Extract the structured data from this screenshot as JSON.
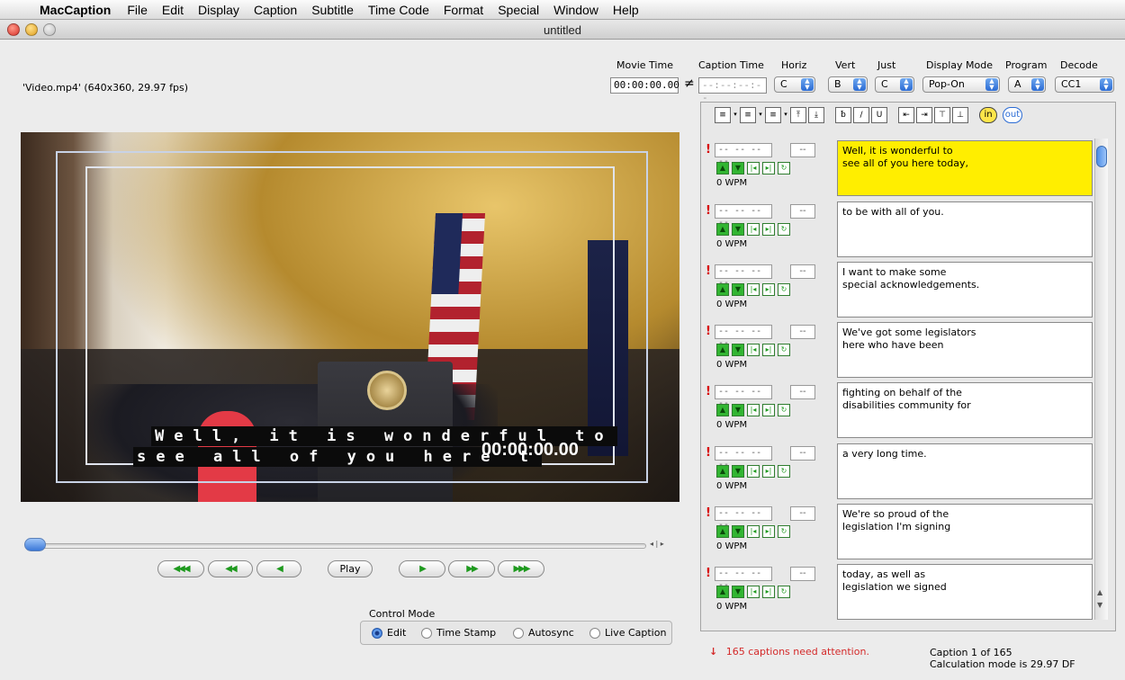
{
  "menubar": {
    "app_name": "MacCaption",
    "items": [
      "File",
      "Edit",
      "Display",
      "Caption",
      "Subtitle",
      "Time Code",
      "Format",
      "Special",
      "Window",
      "Help"
    ]
  },
  "window": {
    "title": "untitled"
  },
  "file_info": "'Video.mp4'  (640x360, 29.97 fps)",
  "controls": {
    "movie_time_label": "Movie Time",
    "movie_time_value": "00:00:00.00",
    "neq_symbol": "≠",
    "caption_time_label": "Caption Time",
    "caption_time_value": "--:--:--:--",
    "horiz_label": "Horiz",
    "horiz_value": "C",
    "vert_label": "Vert",
    "vert_value": "B",
    "just_label": "Just",
    "just_value": "C",
    "display_mode_label": "Display Mode",
    "display_mode_value": "Pop-On",
    "program_label": "Program",
    "program_value": "A",
    "decode_label": "Decode",
    "decode_value": "CC1"
  },
  "video": {
    "caption_line1": "Well, it is wonderful to",
    "caption_line2": "see all of you here t",
    "timecode_overlay": "00:00:00.00"
  },
  "transport": {
    "play_label": "Play",
    "rewind_fast": "◀◀◀",
    "rewind": "◀◀",
    "step_back": "◀",
    "step_fwd": "▶",
    "fwd": "▶▶",
    "fwd_fast": "▶▶▶"
  },
  "control_mode": {
    "label": "Control Mode",
    "options": [
      "Edit",
      "Time Stamp",
      "Autosync",
      "Live Caption"
    ],
    "selected": "Edit"
  },
  "caption_toolbar": {
    "in_label": "in",
    "out_label": "out"
  },
  "captions": [
    {
      "tc_in": "-- -- -- --",
      "dur": "--",
      "wpm": "0 WPM",
      "text": "Well, it is wonderful to\nsee all of you here today,",
      "selected": true
    },
    {
      "tc_in": "-- -- -- --",
      "dur": "--",
      "wpm": "0 WPM",
      "text": "to be with all of you."
    },
    {
      "tc_in": "-- -- -- --",
      "dur": "--",
      "wpm": "0 WPM",
      "text": "I want to make some\nspecial acknowledgements."
    },
    {
      "tc_in": "-- -- -- --",
      "dur": "--",
      "wpm": "0 WPM",
      "text": "We've got some legislators\nhere who have been"
    },
    {
      "tc_in": "-- -- -- --",
      "dur": "--",
      "wpm": "0 WPM",
      "text": "fighting on behalf of the\ndisabilities community for"
    },
    {
      "tc_in": "-- -- -- --",
      "dur": "--",
      "wpm": "0 WPM",
      "text": "a very long time."
    },
    {
      "tc_in": "-- -- -- --",
      "dur": "--",
      "wpm": "0 WPM",
      "text": "We're so proud of the\nlegislation I'm signing"
    },
    {
      "tc_in": "-- -- -- --",
      "dur": "--",
      "wpm": "0 WPM",
      "text": "today, as well as\nlegislation we signed"
    }
  ],
  "footer": {
    "attention_text": "165 captions need attention.",
    "caption_position": "Caption 1 of 165",
    "calc_mode": "Calculation mode is 29.97 DF"
  },
  "colors": {
    "selected_caption": "#ffee00",
    "warning": "#d80000",
    "accent_blue": "#2a6bd4",
    "transport_green": "#1f9a1f"
  }
}
